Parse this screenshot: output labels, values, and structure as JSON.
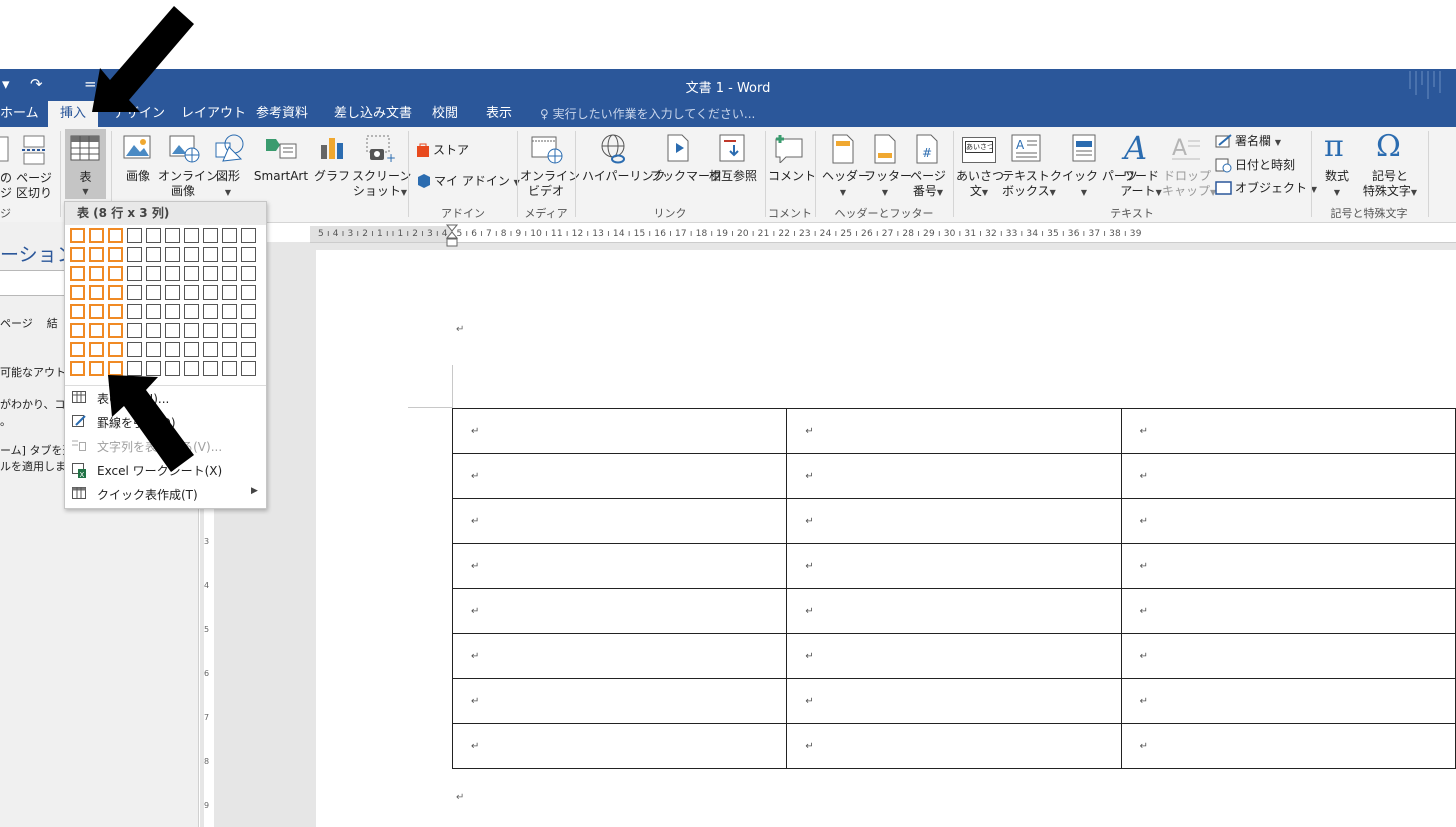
{
  "window": {
    "title": "文書 1 - Word",
    "qat": {
      "undo": "↶",
      "redo": "↷",
      "customize": "="
    }
  },
  "tabs": [
    {
      "label": "ホーム"
    },
    {
      "label": "挿入"
    },
    {
      "label": "デザイン"
    },
    {
      "label": "レイアウト"
    },
    {
      "label": "参考資料"
    },
    {
      "label": "差し込み文書"
    },
    {
      "label": "校閲"
    },
    {
      "label": "表示"
    }
  ],
  "tell_me": "実行したい作業を入力してください...",
  "ribbon": {
    "pages": {
      "cover": "の",
      "cover2": "ジ",
      "page_break": "ページ",
      "page_break2": "区切り"
    },
    "table": "表",
    "illustrations": {
      "pictures": "画像",
      "online_pictures": "オンライン",
      "online_pictures2": "画像",
      "shapes": "図形",
      "smartart": "SmartArt",
      "chart": "グラフ",
      "screenshot": "スクリーン",
      "screenshot2": "ショット"
    },
    "addins": {
      "store": "ストア",
      "my_addins": "マイ アドイン",
      "group": "アドイン"
    },
    "media": {
      "online_video": "オンライン",
      "online_video2": "ビデオ",
      "group": "メディア"
    },
    "links": {
      "hyperlink": "ハイパーリンク",
      "bookmark": "ブックマーク",
      "crossref": "相互参照",
      "group": "リンク"
    },
    "comments": {
      "comment": "コメント",
      "group": "コメント"
    },
    "header_footer": {
      "header": "ヘッダー",
      "footer": "フッター",
      "page_number": "ページ",
      "page_number2": "番号",
      "group": "ヘッダーとフッター"
    },
    "text": {
      "greeting": "あいさつ",
      "greeting2": "文",
      "textbox": "テキスト",
      "textbox2": "ボックス",
      "quickparts": "クイック パーツ",
      "wordart": "ワード",
      "wordart2": "アート",
      "dropcap": "ドロップ",
      "dropcap2": "キャップ",
      "signature": "署名欄",
      "datetime": "日付と時刻",
      "object": "オブジェクト",
      "group": "テキスト",
      "greeting_icon_text": "あいさつ"
    },
    "symbols": {
      "equation": "数式",
      "symbol": "記号と",
      "symbol2": "特殊文字",
      "group": "記号と特殊文字"
    },
    "pages_group": "ジ"
  },
  "table_menu": {
    "title": "表 (8 行 x 3 列)",
    "grid": {
      "rows": 8,
      "cols": 10,
      "selected_rows": 8,
      "selected_cols": 3
    },
    "items": [
      {
        "label": "表の挿入(I)..."
      },
      {
        "label": "罫線を引く(D)"
      },
      {
        "label": "文字列を表にする(V)...",
        "disabled": true
      },
      {
        "label": "Excel ワークシート(X)"
      },
      {
        "label": "クイック表作成(T)"
      }
    ]
  },
  "nav_pane": {
    "title": "ーション",
    "tabs_text": "ページ    結",
    "line1": "可能なアウトラ",
    "line2": "がわかり、コンテ",
    "line3": "。",
    "line4": "ーム] タブを選",
    "line5": "ルを適用します"
  },
  "ruler": {
    "h_text": "5 ı 4 ı 3 ı 2 ı 1 ı  ı 1 ı 2 ı 3 ı 4 ı 5 ı 6 ı 7 ı 8 ı 9 ı 10 ı 11 ı 12 ı 13 ı 14 ı 15 ı 16 ı 17 ı 18 ı 19 ı 20 ı 21 ı 22 ı 23 ı 24 ı 25 ı 26 ı 27 ı 28 ı 29 ı 30 ı 31 ı 32 ı 33 ı 34 ı 35 ı 36 ı 37 ı 38 ı 39",
    "v_numbers": [
      "3",
      "4",
      "5",
      "6",
      "7",
      "8",
      "9"
    ]
  },
  "document": {
    "paragraph_mark": "↵",
    "table": {
      "rows": 8,
      "cols": 3
    }
  },
  "colors": {
    "titlebar": "#2b579a",
    "grid_highlight": "#f08a24",
    "ribbon_bg": "#f3f3f3"
  }
}
